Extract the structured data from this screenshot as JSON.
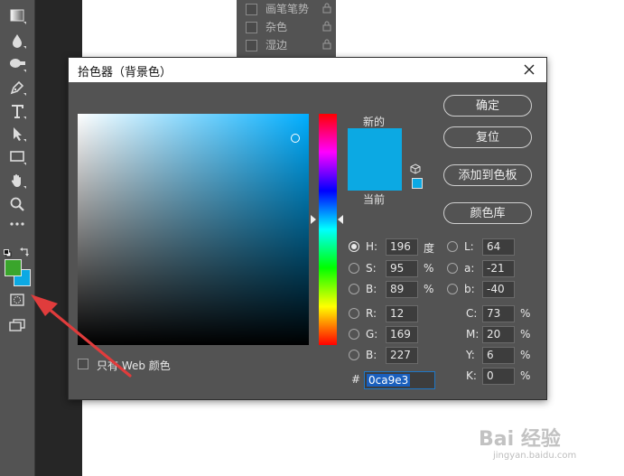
{
  "layers_panel": {
    "rows": [
      {
        "label": "画笔笔势"
      },
      {
        "label": "杂色"
      },
      {
        "label": "湿边"
      }
    ]
  },
  "dialog": {
    "title": "拾色器（背景色）",
    "new_label": "新的",
    "current_label": "当前",
    "buttons": {
      "ok": "确定",
      "reset": "复位",
      "add_to_swatches": "添加到色板",
      "color_libraries": "颜色库"
    },
    "fields": {
      "H": {
        "label": "H:",
        "value": "196",
        "unit": "度"
      },
      "S": {
        "label": "S:",
        "value": "95",
        "unit": "%"
      },
      "B": {
        "label": "B:",
        "value": "89",
        "unit": "%"
      },
      "R": {
        "label": "R:",
        "value": "12"
      },
      "G": {
        "label": "G:",
        "value": "169"
      },
      "Bl": {
        "label": "B:",
        "value": "227"
      },
      "L": {
        "label": "L:",
        "value": "64"
      },
      "a": {
        "label": "a:",
        "value": "-21"
      },
      "b": {
        "label": "b:",
        "value": "-40"
      },
      "C": {
        "label": "C:",
        "value": "73",
        "unit": "%"
      },
      "M": {
        "label": "M:",
        "value": "20",
        "unit": "%"
      },
      "Y": {
        "label": "Y:",
        "value": "6",
        "unit": "%"
      },
      "K": {
        "label": "K:",
        "value": "0",
        "unit": "%"
      }
    },
    "hex_label": "#",
    "hex_value": "0ca9e3",
    "web_only_label": "只有 Web 颜色",
    "selected_color": "#0ca9e3"
  },
  "toolbar": {
    "foreground_color": "#3aa52c",
    "background_color": "#0ca9e3"
  },
  "watermark": {
    "logo": "Bai 经验",
    "sub": "jingyan.baidu.com"
  },
  "colors": {
    "ui_panel": "#535353",
    "annotation_arrow": "#e03c3c"
  }
}
